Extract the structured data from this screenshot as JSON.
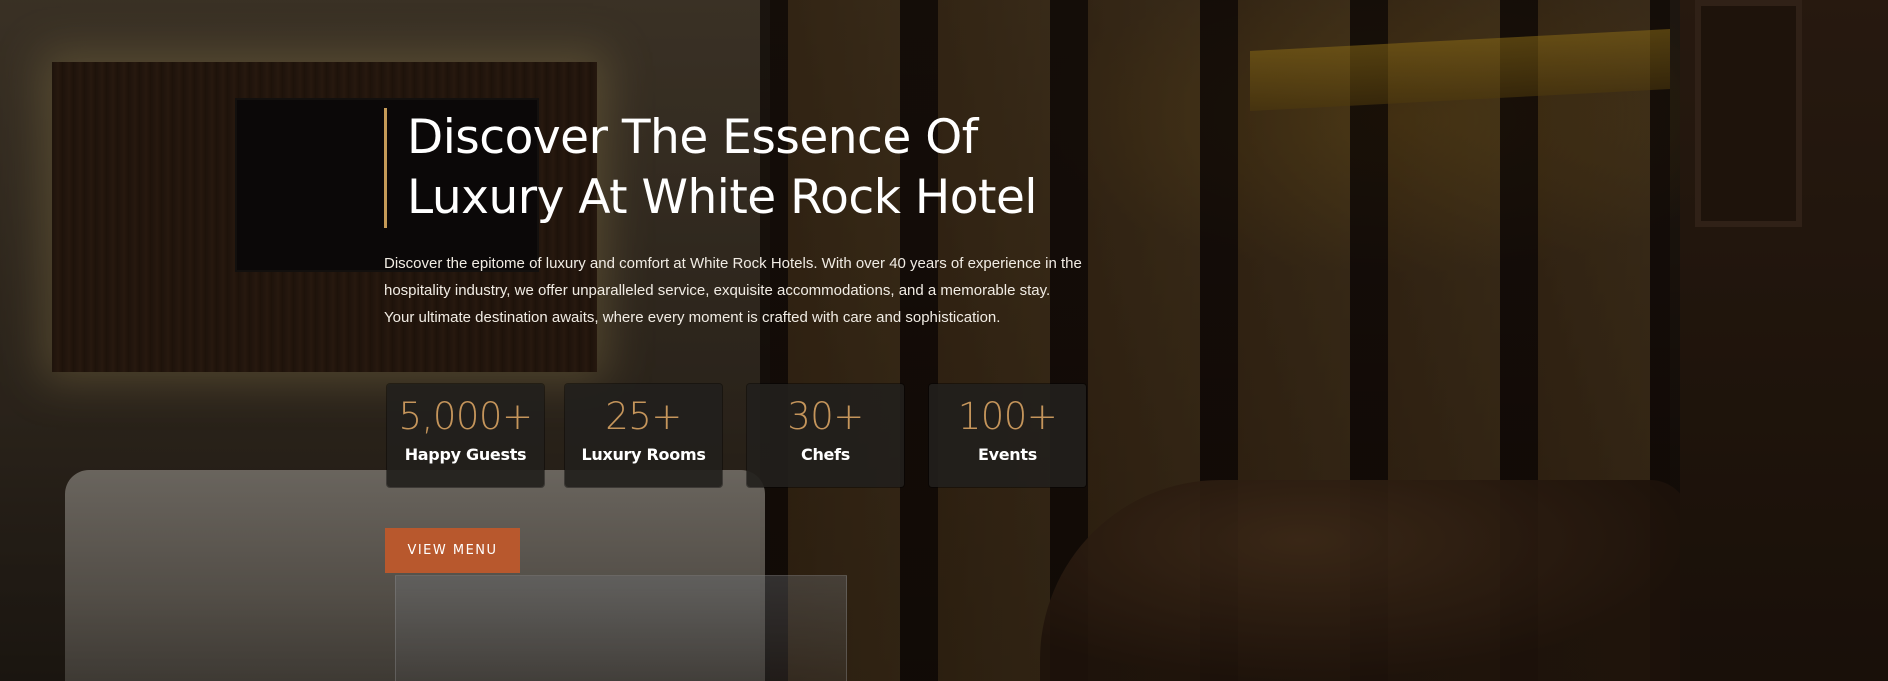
{
  "hero": {
    "title_line1": "Discover The Essence Of",
    "title_line2": "Luxury At White Rock Hotel",
    "description": "Discover the epitome of luxury and comfort at White Rock Hotels. With over 40 years of experience in the hospitality industry, we offer unparalleled service, exquisite accommodations, and a memorable stay. Your ultimate destination awaits, where every moment is crafted with care and sophistication.",
    "cta_label": "VIEW MENU"
  },
  "stats": [
    {
      "value": "5,000+",
      "label": "Happy Guests"
    },
    {
      "value": "25+",
      "label": "Luxury Rooms"
    },
    {
      "value": "30+",
      "label": "Chefs"
    },
    {
      "value": "100+",
      "label": "Events"
    }
  ],
  "colors": {
    "accent_gold": "#c5955b",
    "button": "#b8582d",
    "stat_card": "#221f1c",
    "text": "#ffffff"
  }
}
